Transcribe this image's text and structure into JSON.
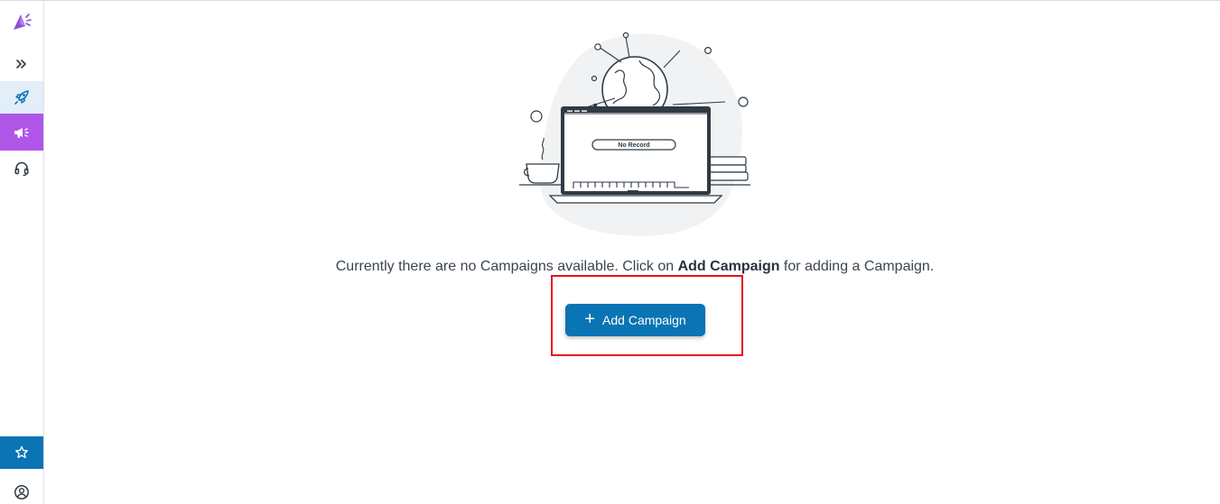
{
  "sidebar": {
    "items": [
      {
        "name": "logo",
        "icon": "megaphone-logo-icon"
      },
      {
        "name": "expand",
        "icon": "chevrons-right-icon"
      },
      {
        "name": "rocket",
        "icon": "rocket-icon"
      },
      {
        "name": "campaigns",
        "icon": "megaphone-icon",
        "active": true
      },
      {
        "name": "support",
        "icon": "headset-icon"
      },
      {
        "name": "favorites",
        "icon": "star-icon"
      },
      {
        "name": "account",
        "icon": "user-circle-icon"
      }
    ]
  },
  "empty_state": {
    "illustration_label": "No Record",
    "message_prefix": "Currently there are no Campaigns available. Click on ",
    "message_bold": "Add Campaign",
    "message_suffix": " for adding a Campaign."
  },
  "actions": {
    "add_button_icon": "+",
    "add_button_label": "Add Campaign"
  },
  "colors": {
    "primary": "#0a74b4",
    "accent_purple": "#b056e8",
    "highlight_red": "#e8101a",
    "active_item_bg": "#e2eef8"
  }
}
